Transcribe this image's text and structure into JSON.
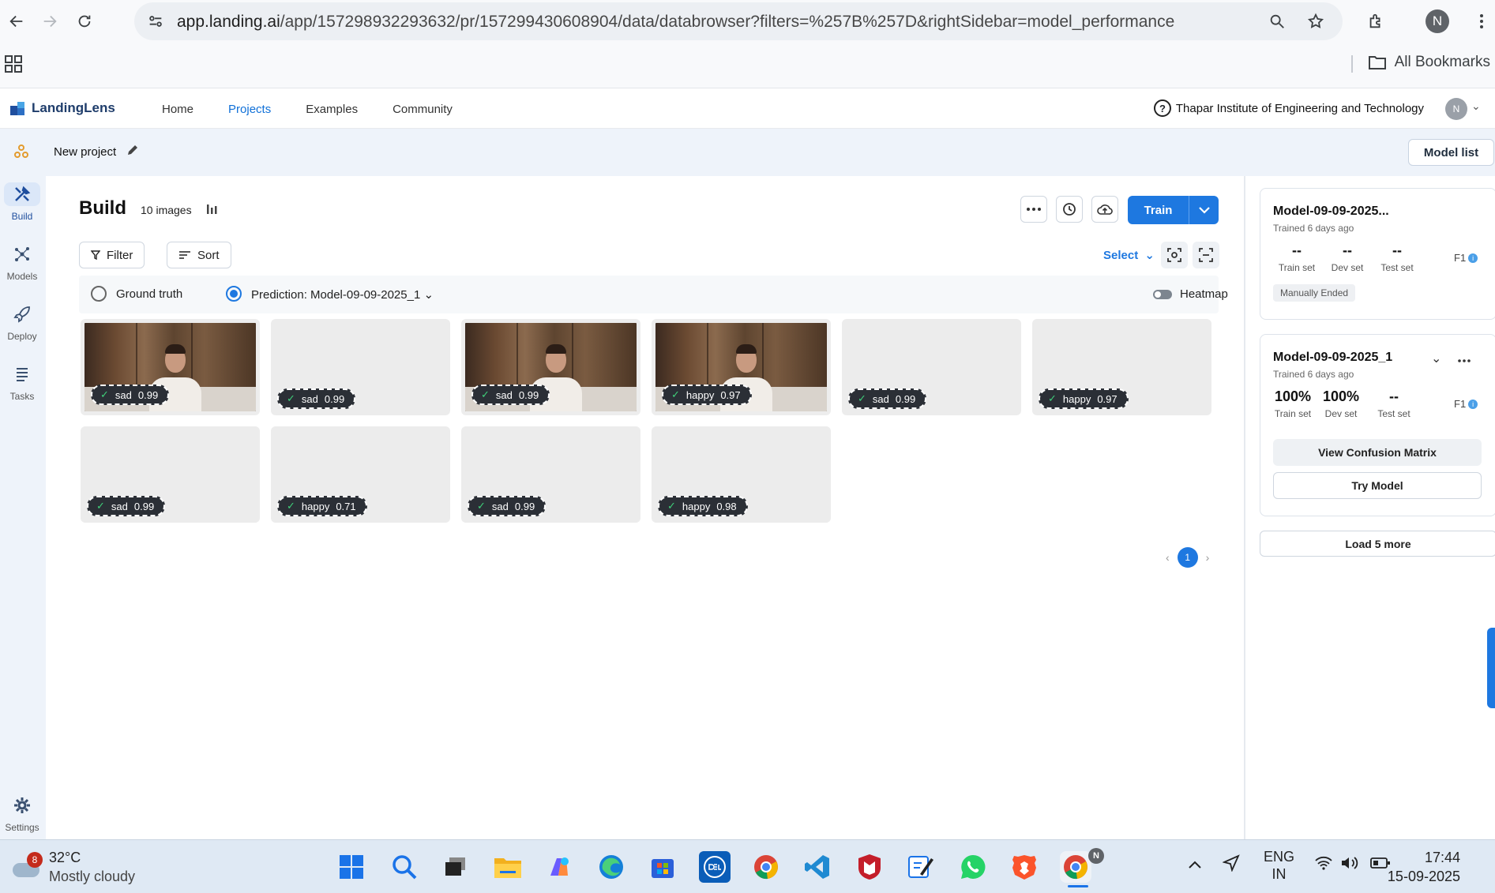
{
  "browser": {
    "url_host": "app.landing.ai",
    "url_path": "/app/157298932293632/pr/157299430608904/data/databrowser?filters=%257B%257D&rightSidebar=model_performance",
    "profile_initial": "N",
    "all_bookmarks": "All Bookmarks"
  },
  "app": {
    "logo": "LandingLens",
    "nav": [
      "Home",
      "Projects",
      "Examples",
      "Community"
    ],
    "active_nav": "Projects",
    "org": "Thapar Institute of Engineering and Technology",
    "avatar_initial": "N",
    "help": "?"
  },
  "project": {
    "name": "New project",
    "model_list": "Model list"
  },
  "rail": {
    "build": "Build",
    "models": "Models",
    "deploy": "Deploy",
    "tasks": "Tasks",
    "settings": "Settings"
  },
  "build": {
    "title": "Build",
    "image_count": "10 images",
    "train": "Train",
    "filter": "Filter",
    "sort": "Sort",
    "select": "Select",
    "ground_truth": "Ground truth",
    "prediction": "Prediction: Model-09-09-2025_1",
    "heatmap": "Heatmap",
    "page": "1"
  },
  "images": [
    {
      "label": "sad",
      "score": "0.99",
      "photo": true
    },
    {
      "label": "sad",
      "score": "0.99",
      "photo": false
    },
    {
      "label": "sad",
      "score": "0.99",
      "photo": true
    },
    {
      "label": "happy",
      "score": "0.97",
      "photo": true
    },
    {
      "label": "sad",
      "score": "0.99",
      "photo": false
    },
    {
      "label": "happy",
      "score": "0.97",
      "photo": false
    },
    {
      "label": "sad",
      "score": "0.99",
      "photo": false
    },
    {
      "label": "happy",
      "score": "0.71",
      "photo": false
    },
    {
      "label": "sad",
      "score": "0.99",
      "photo": false
    },
    {
      "label": "happy",
      "score": "0.98",
      "photo": false
    }
  ],
  "models": [
    {
      "name": "Model-09-09-2025...",
      "trained": "Trained 6 days ago",
      "train": "--",
      "dev": "--",
      "test": "--",
      "train_label": "Train set",
      "dev_label": "Dev set",
      "test_label": "Test set",
      "f1": "F1",
      "status": "Manually Ended"
    },
    {
      "name": "Model-09-09-2025_1",
      "trained": "Trained 6 days ago",
      "train": "100%",
      "dev": "100%",
      "test": "--",
      "train_label": "Train set",
      "dev_label": "Dev set",
      "test_label": "Test set",
      "f1": "F1",
      "confusion": "View Confusion Matrix",
      "try": "Try Model"
    }
  ],
  "load_more": "Load 5 more",
  "taskbar": {
    "temp": "32°C",
    "weather": "Mostly cloudy",
    "weather_badge": "8",
    "lang1": "ENG",
    "lang2": "IN",
    "time": "17:44",
    "date": "15-09-2025"
  }
}
